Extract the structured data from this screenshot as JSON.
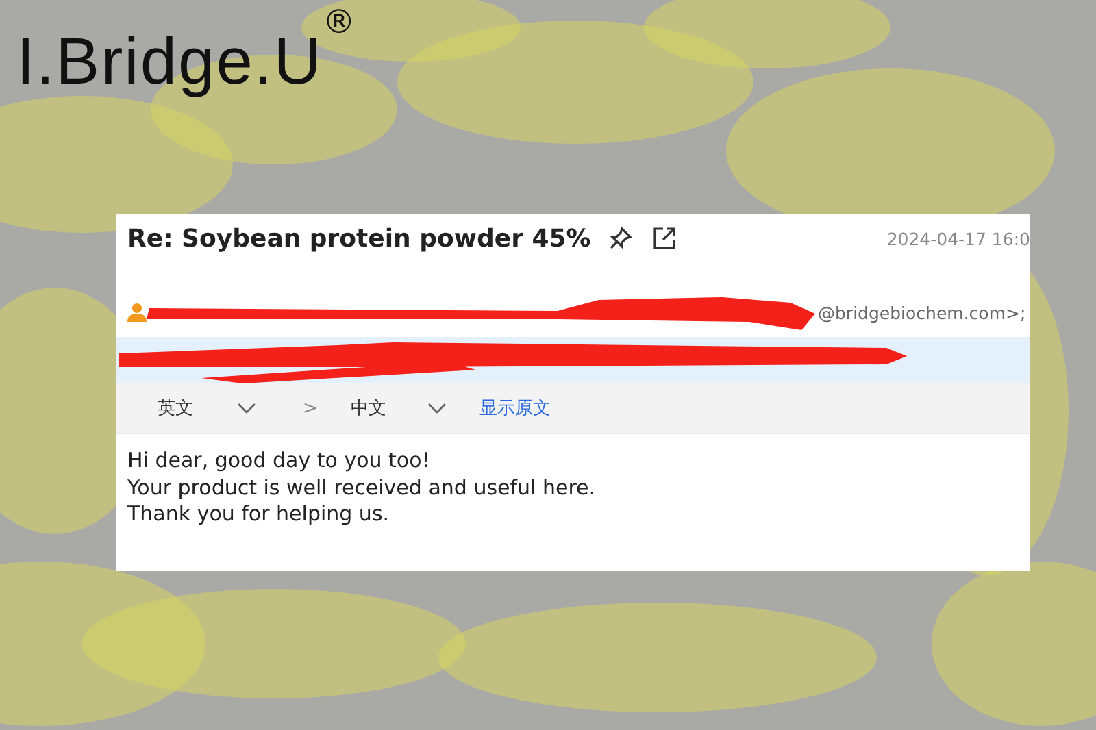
{
  "logo": {
    "text": "I.Bridge.U",
    "mark": "®"
  },
  "email": {
    "subject": "Re: Soybean protein powder 45%",
    "date": "2024-04-17 16:0",
    "sender": {
      "redacted": true,
      "visible_part": "@bridgebiochem.com>;"
    },
    "recipients": {
      "redacted": true
    },
    "translation": {
      "source": "英文",
      "separator": ">",
      "target": "中文",
      "show_original": "显示原文"
    },
    "body": [
      "Hi dear, good day to you too!",
      "Your product is well received and useful here.",
      "Thank you for helping us."
    ]
  }
}
